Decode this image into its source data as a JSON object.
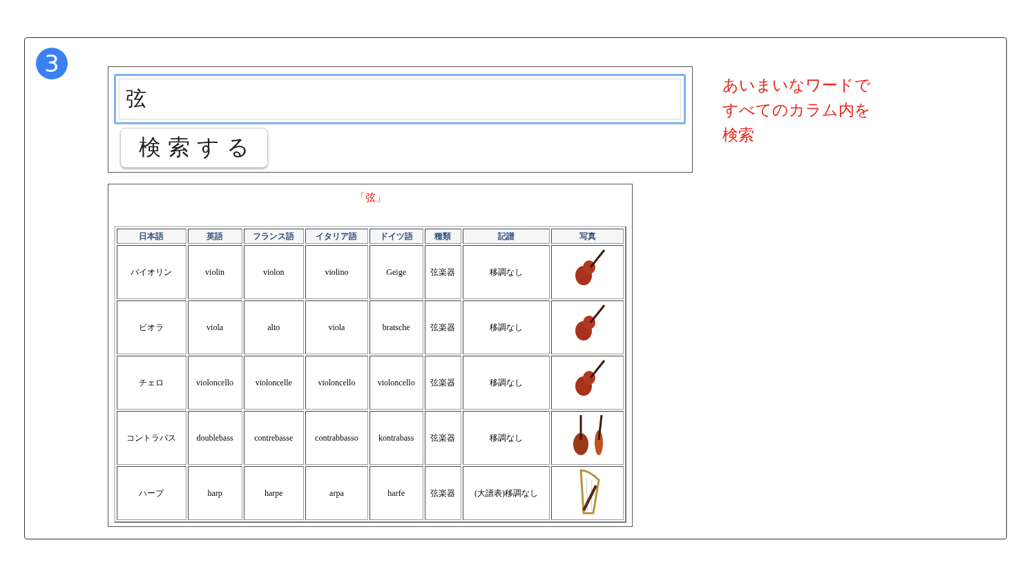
{
  "step_badge": "3",
  "search": {
    "value": "弦",
    "button": "検 索 す る"
  },
  "results": {
    "caption": "「弦」",
    "columns": [
      "日本語",
      "英語",
      "フランス語",
      "イタリア語",
      "ドイツ語",
      "種類",
      "記譜",
      "写真"
    ],
    "rows": [
      {
        "cells": [
          "バイオリン",
          "violin",
          "violon",
          "violino",
          "Geige",
          "弦楽器",
          "移調なし"
        ],
        "kind": "violin"
      },
      {
        "cells": [
          "ビオラ",
          "viola",
          "alto",
          "viola",
          "bratsche",
          "弦楽器",
          "移調なし"
        ],
        "kind": "violin"
      },
      {
        "cells": [
          "チェロ",
          "violoncello",
          "violoncelle",
          "violoncello",
          "violoncello",
          "弦楽器",
          "移調なし"
        ],
        "kind": "violin"
      },
      {
        "cells": [
          "コントラバス",
          "doublebass",
          "contrebasse",
          "contrabbasso",
          "kontrabass",
          "弦楽器",
          "移調なし"
        ],
        "kind": "bass"
      },
      {
        "cells": [
          "ハープ",
          "harp",
          "harpe",
          "arpa",
          "harfe",
          "弦楽器",
          "(大譜表)移調なし"
        ],
        "kind": "harp"
      }
    ]
  },
  "note_lines": [
    "あいまいなワードで",
    "すべてのカラム内を",
    "検索"
  ]
}
